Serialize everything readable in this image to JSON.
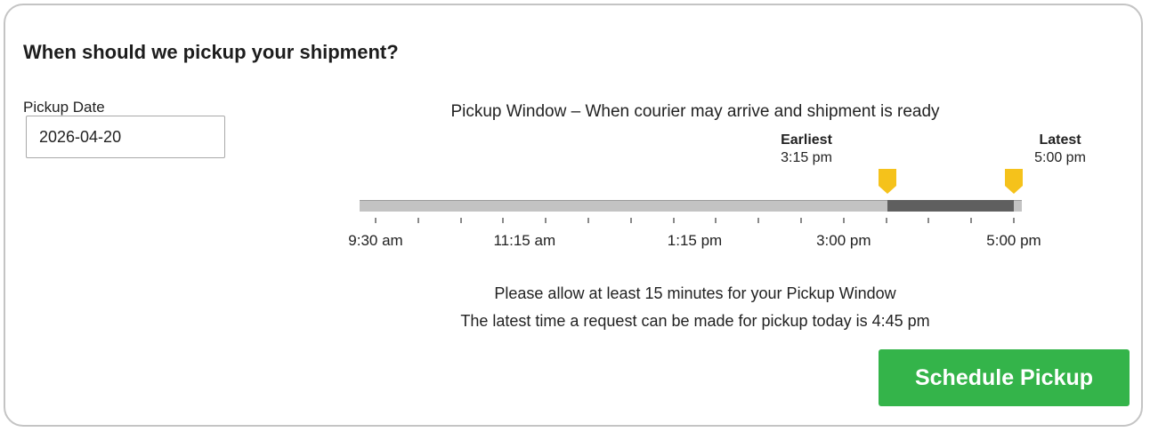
{
  "form": {
    "title": "When should we pickup your shipment?",
    "date_label": "Pickup Date",
    "date_value": "2026-04-20"
  },
  "window": {
    "title": "Pickup Window – When courier may arrive and shipment is ready",
    "earliest_label": "Earliest",
    "earliest_time": "3:15 pm",
    "latest_label": "Latest",
    "latest_time": "5:00 pm",
    "timeline_start_minutes": 570,
    "timeline_end_minutes": 1020,
    "selected_start_minutes": 915,
    "selected_end_minutes": 1020,
    "tick_interval_minutes": 15,
    "tick_labels": [
      {
        "text": "9:30 am",
        "minutes": 570
      },
      {
        "text": "11:15 am",
        "minutes": 675
      },
      {
        "text": "1:15 pm",
        "minutes": 795
      },
      {
        "text": "3:00 pm",
        "minutes": 900
      },
      {
        "text": "5:00 pm",
        "minutes": 1020
      }
    ]
  },
  "notes": {
    "min_window": "Please allow at least 15 minutes for your Pickup Window",
    "latest_request": "The latest time a request can be made for pickup today is 4:45 pm"
  },
  "actions": {
    "schedule_label": "Schedule Pickup"
  },
  "colors": {
    "marker": "#f5c21b",
    "range": "#5f5f5f",
    "track": "#c3c3c3",
    "button": "#34b44a"
  },
  "icons": {
    "marker": "map-pin-marker-icon"
  }
}
